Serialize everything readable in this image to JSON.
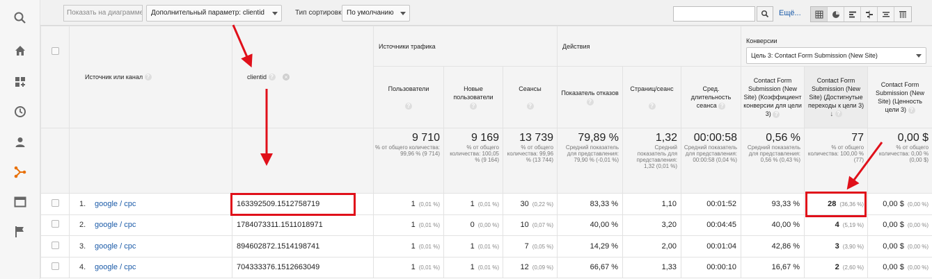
{
  "toolbar": {
    "show_on_chart": "Показать на диаграмме",
    "secondary_dimension": "Дополнительный параметр: clientid",
    "sort_type_label": "Тип сортировки:",
    "sort_type_value": "По умолчанию",
    "search_placeholder": "",
    "more": "Ещё..."
  },
  "table": {
    "header": {
      "source_channel": "Источник или канал",
      "clientid": "clientid",
      "traffic_sources": "Источники трафика",
      "actions": "Действия",
      "conversions": "Конверсии",
      "goal_select": "Цель 3: Contact Form Submission (New Site)",
      "help_glyph": "?",
      "close_glyph": "×",
      "sort_glyph": "↓",
      "metrics": [
        "Пользователи",
        "Новые пользователи",
        "Сеансы",
        "Показатель отказов",
        "Страниц/сеанс",
        "Сред. длительность сеанса",
        "Contact Form Submission (New Site) (Коэффициент конверсии для цели 3)",
        "Contact Form Submission (New Site) (Достигнутые переходы к цели 3)",
        "Contact Form Submission (New Site) (Ценность цели 3)"
      ]
    },
    "totals": [
      {
        "value": "9 710",
        "note": "% от общего количества: 99,96 % (9 714)"
      },
      {
        "value": "9 169",
        "note": "% от общего количества: 100,05 % (9 164)"
      },
      {
        "value": "13 739",
        "note": "% от общего количества: 99,96 % (13 744)"
      },
      {
        "value": "79,89 %",
        "note": "Средний показатель для представления: 79,90 % (-0,01 %)"
      },
      {
        "value": "1,32",
        "note": "Средний показатель для представления: 1,32 (0,01 %)"
      },
      {
        "value": "00:00:58",
        "note": "Средний показатель для представления: 00:00:58 (0,04 %)"
      },
      {
        "value": "0,56 %",
        "note": "Средний показатель для представления: 0,56 % (0,43 %)"
      },
      {
        "value": "77",
        "note": "% от общего количества: 100,00 % (77)"
      },
      {
        "value": "0,00 $",
        "note": "% от общего количества: 0,00 % (0,00 $)"
      }
    ],
    "rows": [
      {
        "index": "1.",
        "source": "google / cpc",
        "clientid": "163392509.1512758719",
        "users": "1",
        "users_pct": "(0,01 %)",
        "new_users": "1",
        "new_users_pct": "(0,01 %)",
        "sessions": "30",
        "sessions_pct": "(0,22 %)",
        "bounce": "83,33 %",
        "pages": "1,10",
        "duration": "00:01:52",
        "conv_rate": "93,33 %",
        "completions": "28",
        "completions_pct": "(36,36 %)",
        "value": "0,00 $",
        "value_pct": "(0,00 %)"
      },
      {
        "index": "2.",
        "source": "google / cpc",
        "clientid": "1784073311.1511018971",
        "users": "1",
        "users_pct": "(0,01 %)",
        "new_users": "0",
        "new_users_pct": "(0,00 %)",
        "sessions": "10",
        "sessions_pct": "(0,07 %)",
        "bounce": "40,00 %",
        "pages": "3,20",
        "duration": "00:04:45",
        "conv_rate": "40,00 %",
        "completions": "4",
        "completions_pct": "(5,19 %)",
        "value": "0,00 $",
        "value_pct": "(0,00 %)"
      },
      {
        "index": "3.",
        "source": "google / cpc",
        "clientid": "894602872.1514198741",
        "users": "1",
        "users_pct": "(0,01 %)",
        "new_users": "1",
        "new_users_pct": "(0,01 %)",
        "sessions": "7",
        "sessions_pct": "(0,05 %)",
        "bounce": "14,29 %",
        "pages": "2,00",
        "duration": "00:01:04",
        "conv_rate": "42,86 %",
        "completions": "3",
        "completions_pct": "(3,90 %)",
        "value": "0,00 $",
        "value_pct": "(0,00 %)"
      },
      {
        "index": "4.",
        "source": "google / cpc",
        "clientid": "704333376.1512663049",
        "users": "1",
        "users_pct": "(0,01 %)",
        "new_users": "1",
        "new_users_pct": "(0,01 %)",
        "sessions": "12",
        "sessions_pct": "(0,09 %)",
        "bounce": "66,67 %",
        "pages": "1,33",
        "duration": "00:00:10",
        "conv_rate": "16,67 %",
        "completions": "2",
        "completions_pct": "(2,60 %)",
        "value": "0,00 $",
        "value_pct": "(0,00 %)"
      }
    ]
  },
  "colors": {
    "annotation": "#e0101a",
    "link": "#1a5aa8",
    "nav_active": "#e8710a"
  },
  "nav_icons": [
    "search-icon",
    "home-icon",
    "customization-icon",
    "realtime-clock-icon",
    "audience-person-icon",
    "acquisition-icon",
    "behavior-icon",
    "conversions-flag-icon"
  ]
}
